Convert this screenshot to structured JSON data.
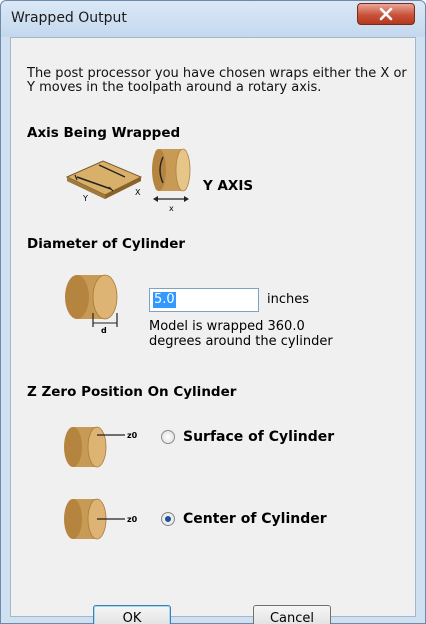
{
  "window": {
    "title": "Wrapped Output",
    "close_icon": "close-icon",
    "colors": {
      "frame": "#cfe0f1",
      "client": "#f0f0f0",
      "close": "#c8523a",
      "wood": "#c79a55"
    }
  },
  "intro_text": "The post processor you have chosen wraps either the X or Y moves in the toolpath around a rotary axis.",
  "axis_section": {
    "heading": "Axis Being Wrapped",
    "flat_icon": "flat-material-xy-icon",
    "flat_axis_y": "Y",
    "flat_axis_x": "X",
    "cylinder_icon": "cylinder-x-axis-icon",
    "cylinder_axis": "x",
    "axis_value": "Y AXIS"
  },
  "diameter_section": {
    "heading": "Diameter of Cylinder",
    "icon": "cylinder-diameter-icon",
    "icon_label": "d",
    "value": "5.0",
    "units": "inches",
    "note": "Model is wrapped 360.0 degrees around the cylinder"
  },
  "zzero_section": {
    "heading": "Z Zero Position On Cylinder",
    "options": [
      {
        "label": "Surface of Cylinder",
        "selected": false,
        "icon_label": "z0",
        "icon": "cylinder-surface-z0-icon"
      },
      {
        "label": "Center of Cylinder",
        "selected": true,
        "icon_label": "z0",
        "icon": "cylinder-center-z0-icon"
      }
    ]
  },
  "buttons": {
    "ok": "OK",
    "cancel": "Cancel"
  }
}
